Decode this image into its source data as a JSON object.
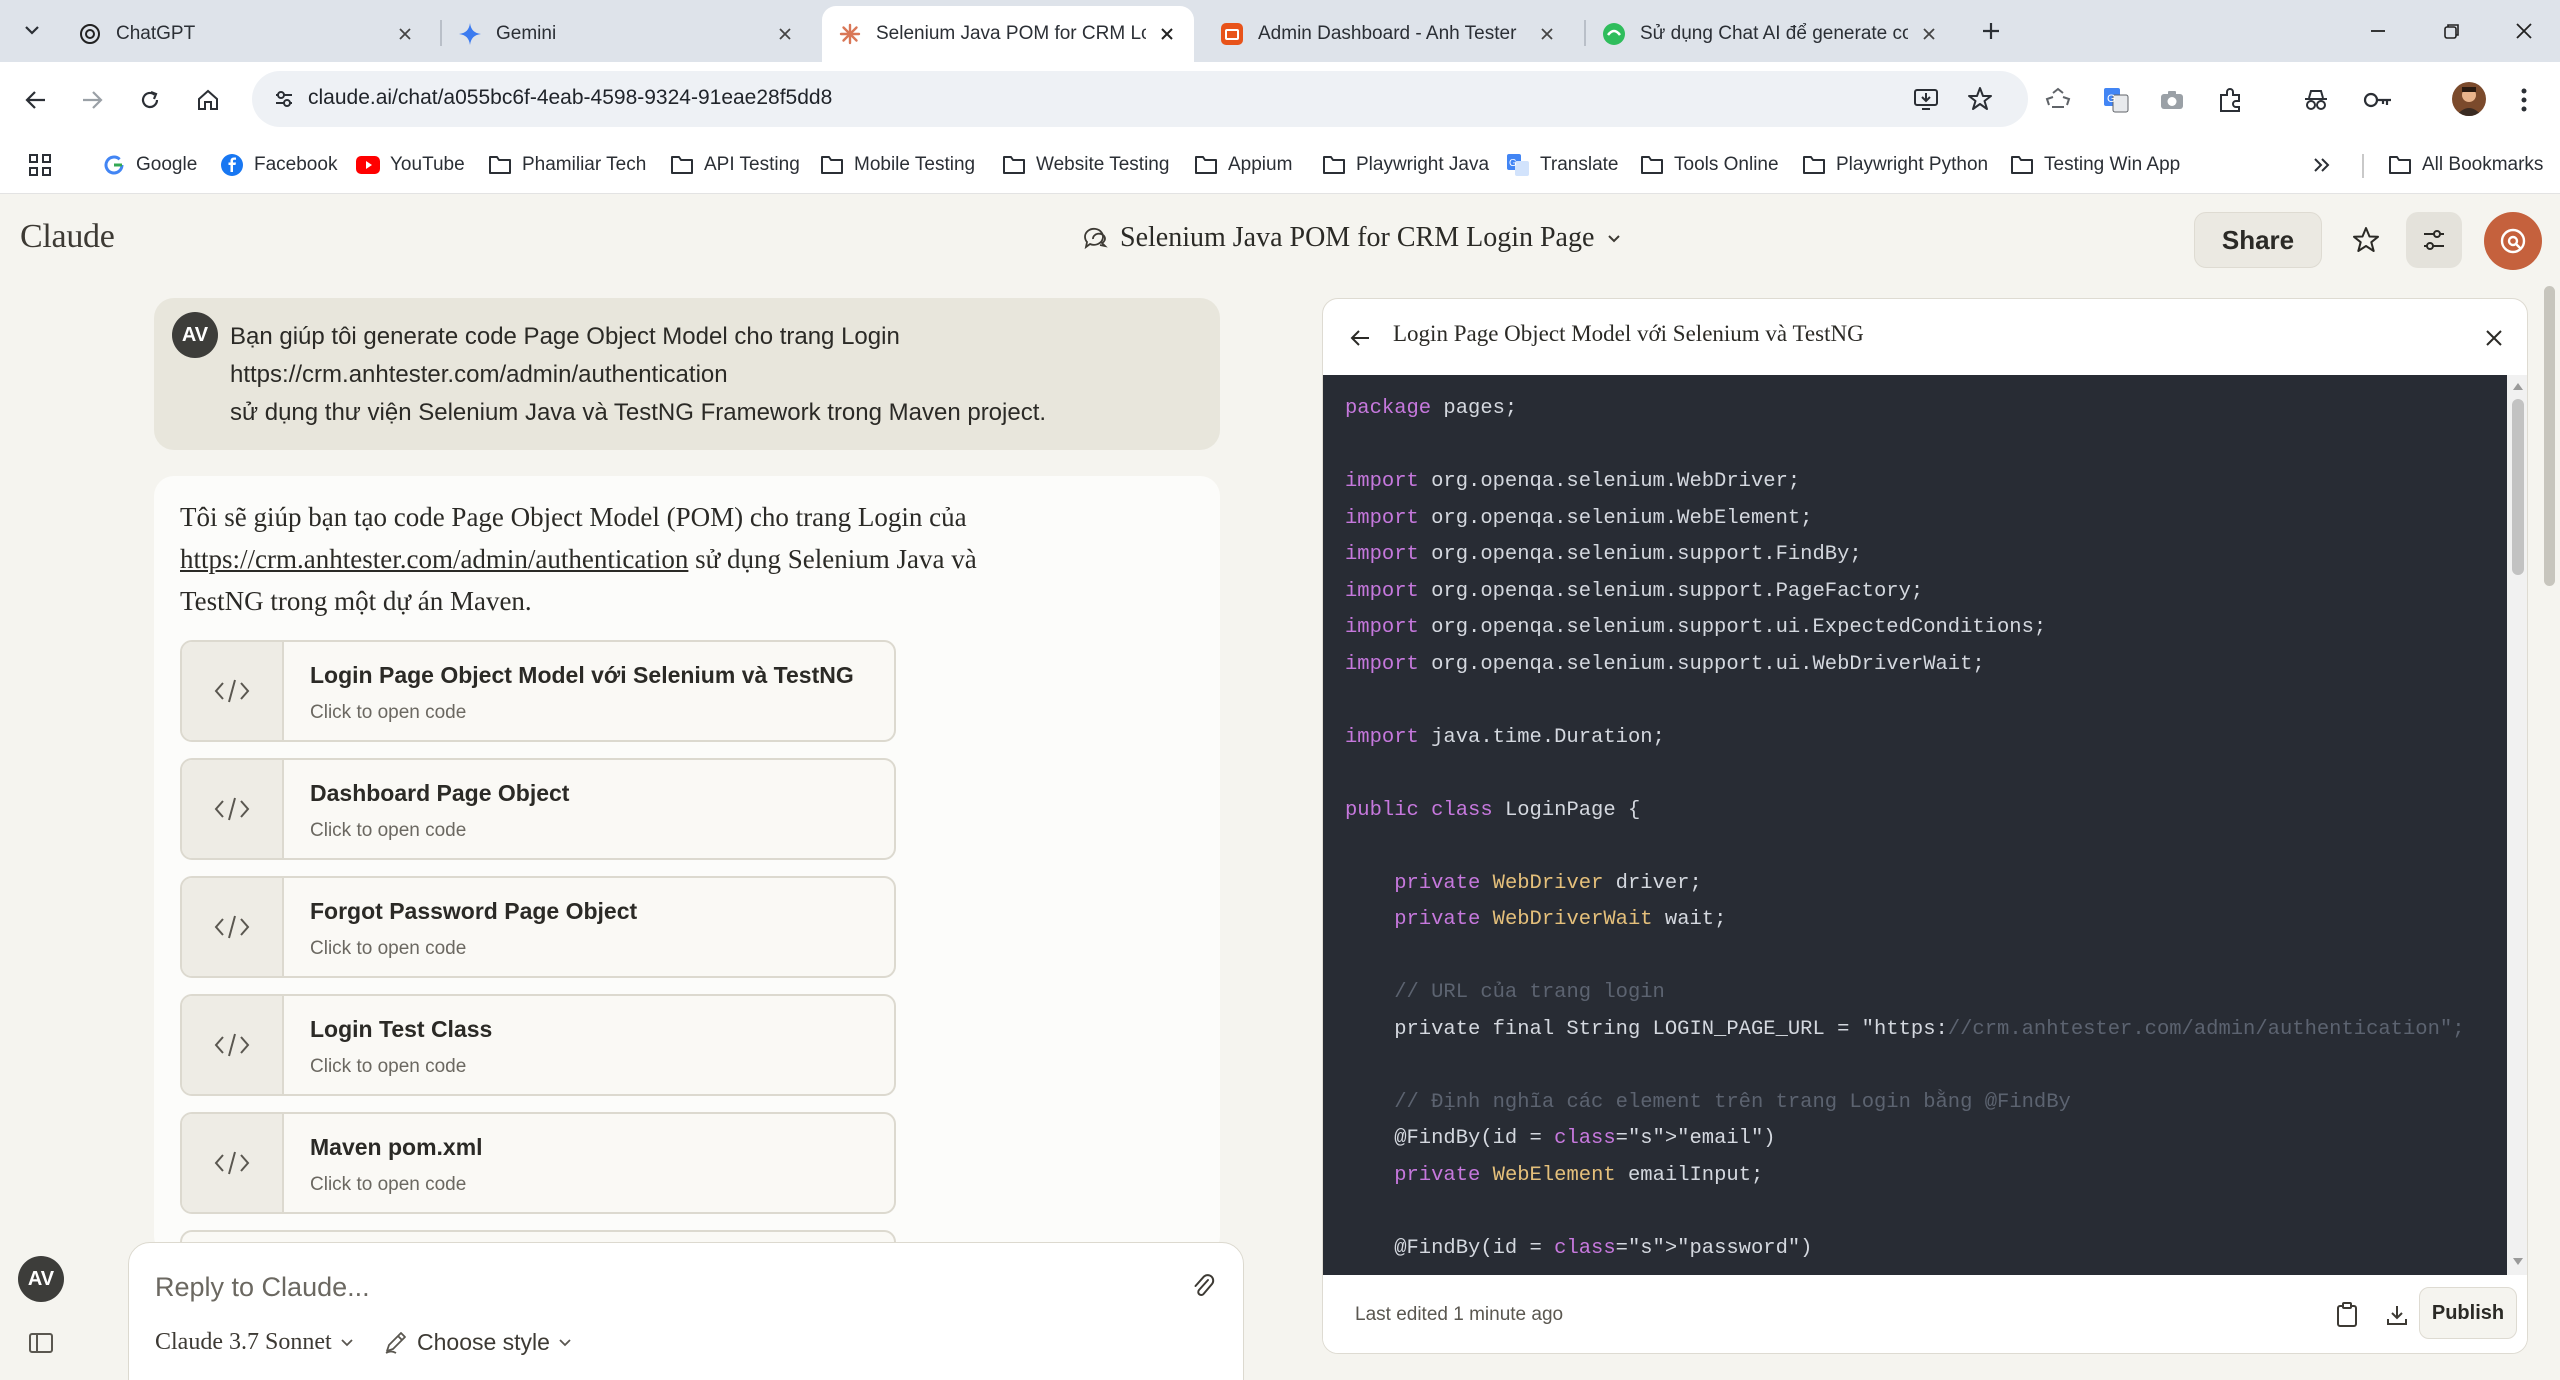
{
  "browser": {
    "tabs": [
      {
        "title": "ChatGPT",
        "icon": "chatgpt-icon"
      },
      {
        "title": "Gemini",
        "icon": "gemini-icon"
      },
      {
        "title": "Selenium Java POM for CRM Login",
        "icon": "claude-icon",
        "active": true
      },
      {
        "title": "Admin Dashboard - Anh Tester",
        "icon": "dashboard-icon"
      },
      {
        "title": "Sử dụng Chat AI để generate code",
        "icon": "chat-icon"
      }
    ],
    "url": "claude.ai/chat/a055bc6f-4eab-4598-9324-91eae28f5dd8",
    "bookmarks": [
      "Google",
      "Facebook",
      "YouTube",
      "Phamiliar Tech",
      "API Testing",
      "Mobile Testing",
      "Website Testing",
      "Appium",
      "Playwright Java",
      "Translate",
      "Tools Online",
      "Playwright Python",
      "Testing Win App"
    ],
    "all_bookmarks": "All Bookmarks"
  },
  "app": {
    "logo": "Claude",
    "chat_title": "Selenium Java POM for CRM Login Page",
    "share_label": "Share",
    "accent": "#c5613d"
  },
  "user_message": {
    "avatar": "AV",
    "lines": [
      "Bạn giúp tôi generate code Page Object Model cho trang Login",
      "https://crm.anhtester.com/admin/authentication",
      "sử dụng thư viện Selenium Java và TestNG Framework trong Maven project."
    ]
  },
  "reply": {
    "intro_before": "Tôi sẽ giúp bạn tạo code Page Object Model (POM) cho trang Login của",
    "intro_link": "https://crm.anhtester.com/admin/authentication",
    "intro_after": "sử dụng Selenium Java và",
    "intro_line3": "TestNG trong một dự án Maven.",
    "artifacts": [
      {
        "title": "Login Page Object Model với Selenium và TestNG",
        "subtitle": "Click to open code"
      },
      {
        "title": "Dashboard Page Object",
        "subtitle": "Click to open code"
      },
      {
        "title": "Forgot Password Page Object",
        "subtitle": "Click to open code"
      },
      {
        "title": "Login Test Class",
        "subtitle": "Click to open code"
      },
      {
        "title": "Maven pom.xml",
        "subtitle": "Click to open code"
      }
    ]
  },
  "composer": {
    "placeholder": "Reply to Claude...",
    "model": "Claude 3.7 Sonnet",
    "style": "Choose style"
  },
  "rail": {
    "avatar": "AV"
  },
  "artifact_panel": {
    "title": "Login Page Object Model với Selenium và TestNG",
    "last_edited": "Last edited 1 minute ago",
    "publish_label": "Publish",
    "code_lines": [
      "package pages;",
      "",
      "import org.openqa.selenium.WebDriver;",
      "import org.openqa.selenium.WebElement;",
      "import org.openqa.selenium.support.FindBy;",
      "import org.openqa.selenium.support.PageFactory;",
      "import org.openqa.selenium.support.ui.ExpectedConditions;",
      "import org.openqa.selenium.support.ui.WebDriverWait;",
      "",
      "import java.time.Duration;",
      "",
      "public class LoginPage {",
      "",
      "    private WebDriver driver;",
      "    private WebDriverWait wait;",
      "",
      "    // URL của trang login",
      "    private final String LOGIN_PAGE_URL = \"https://crm.anhtester.com/admin/authentication\";",
      "",
      "    // Định nghĩa các element trên trang Login bằng @FindBy",
      "    @FindBy(id = \"email\")",
      "    private WebElement emailInput;",
      "",
      "    @FindBy(id = \"password\")"
    ]
  }
}
